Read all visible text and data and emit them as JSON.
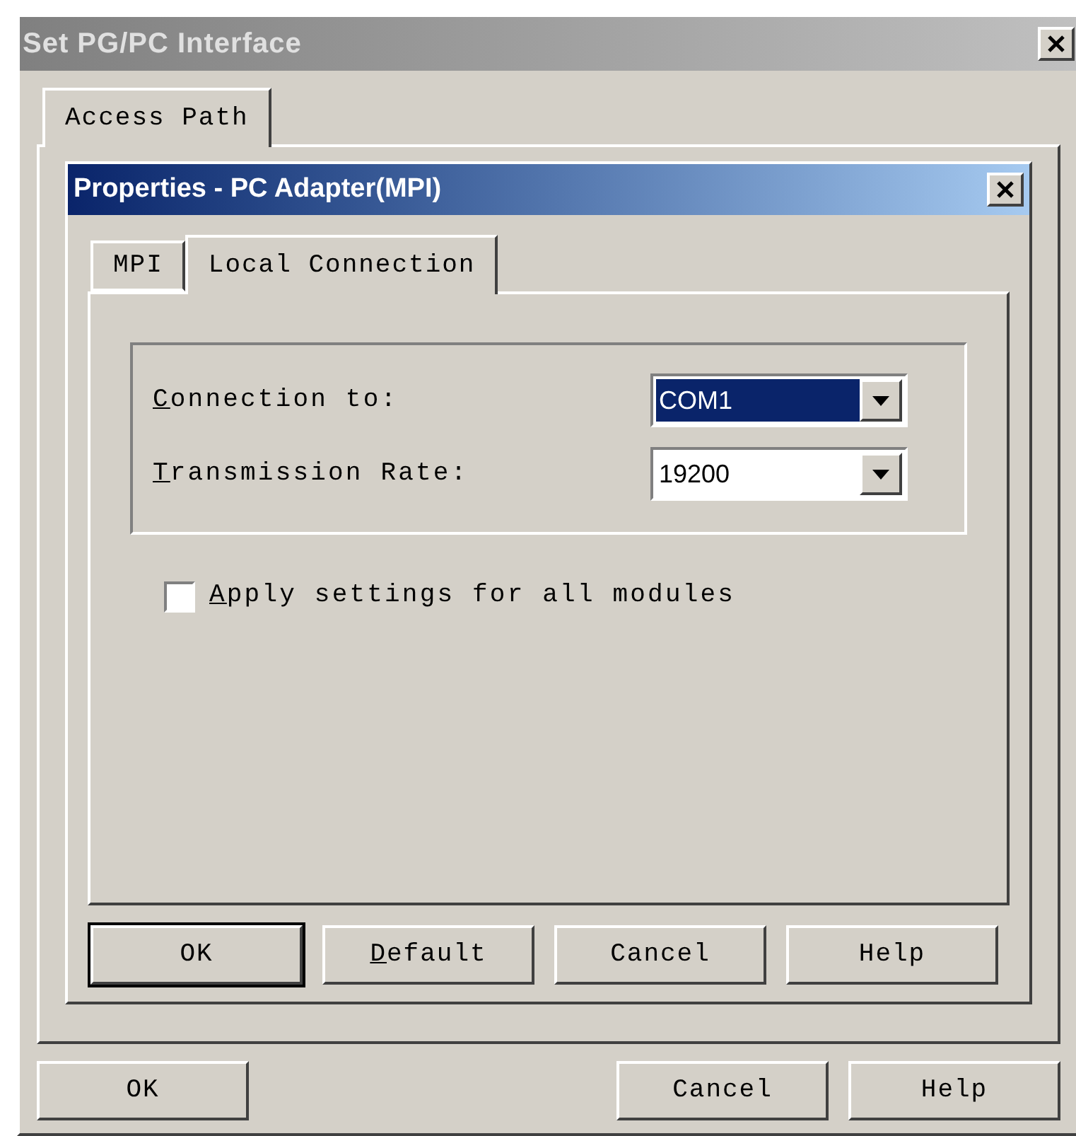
{
  "window": {
    "title": "Set PG/PC Interface",
    "active": false
  },
  "tabs": [
    {
      "label": "Access Path",
      "selected": true
    }
  ],
  "dialog": {
    "title": "Properties - PC Adapter(MPI)",
    "active": true,
    "tabs": [
      {
        "label": "MPI",
        "selected": false
      },
      {
        "label": "Local Connection",
        "selected": true
      }
    ],
    "fields": [
      {
        "label": "Connection to:",
        "access_key": true,
        "value": "COM1",
        "highlighted": true
      },
      {
        "label": "Transmission Rate:",
        "access_key": true,
        "value": "19200",
        "highlighted": false
      }
    ],
    "checkbox": {
      "label": "Apply settings for all modules",
      "access_key": true,
      "checked": false
    },
    "buttons": [
      {
        "label": "OK",
        "access_key": false,
        "default": true
      },
      {
        "label": "Default",
        "access_key": true,
        "default": false
      },
      {
        "label": "Cancel",
        "access_key": false,
        "default": false
      },
      {
        "label": "Help",
        "access_key": false,
        "default": false
      }
    ]
  },
  "buttons": [
    {
      "label": "OK",
      "access_key": false,
      "default": false
    },
    {
      "label": "Cancel",
      "access_key": false,
      "default": false
    },
    {
      "label": "Help",
      "access_key": false,
      "default": false
    }
  ]
}
